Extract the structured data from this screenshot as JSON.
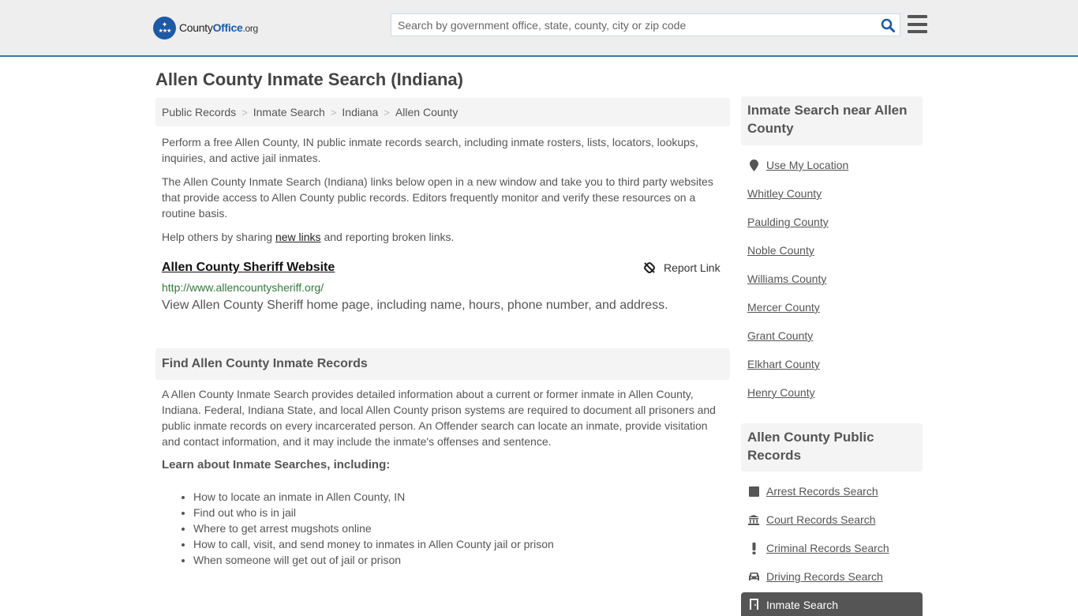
{
  "header": {
    "logo": {
      "brand_part1": "County",
      "brand_part2": "Office",
      "brand_suffix": ".org"
    },
    "search": {
      "placeholder": "Search by government office, state, county, city or zip code",
      "value": ""
    }
  },
  "page": {
    "title": "Allen County Inmate Search (Indiana)"
  },
  "breadcrumb": [
    {
      "label": "Public Records"
    },
    {
      "label": "Inmate Search"
    },
    {
      "label": "Indiana"
    },
    {
      "label": "Allen County"
    }
  ],
  "intro": {
    "para1": "Perform a free Allen County, IN public inmate records search, including inmate rosters, lists, locators, lookups, inquiries, and active jail inmates.",
    "para2": "The Allen County Inmate Search (Indiana) links below open in a new window and take you to third party websites that provide access to Allen County public records. Editors frequently monitor and verify these resources on a routine basis.",
    "para3_before": "Help others by sharing ",
    "para3_link": "new links",
    "para3_after": " and reporting broken links."
  },
  "results": [
    {
      "title": "Allen County Sheriff Website",
      "url": "http://www.allencountysheriff.org/",
      "description": "View Allen County Sheriff home page, including name, hours, phone number, and address.",
      "report_label": "Report Link"
    }
  ],
  "find_section": {
    "heading": "Find Allen County Inmate Records",
    "body": "A Allen County Inmate Search provides detailed information about a current or former inmate in Allen County, Indiana. Federal, Indiana State, and local Allen County prison systems are required to document all prisoners and public inmate records on every incarcerated person. An Offender search can locate an inmate, provide visitation and contact information, and it may include the inmate's offenses and sentence.",
    "learn_heading": "Learn about Inmate Searches, including:",
    "learn_items": [
      "How to locate an inmate in Allen County, IN",
      "Find out who is in jail",
      "Where to get arrest mugshots online",
      "How to call, visit, and send money to inmates in Allen County jail or prison",
      "When someone will get out of jail or prison"
    ]
  },
  "sidebar": {
    "nearby": {
      "heading": "Inmate Search near Allen County",
      "use_location": "Use My Location",
      "counties": [
        "Whitley County",
        "Paulding County",
        "Noble County",
        "Williams County",
        "Mercer County",
        "Grant County",
        "Elkhart County",
        "Henry County"
      ]
    },
    "public_records": {
      "heading": "Allen County Public Records",
      "items": [
        {
          "label": "Arrest Records Search",
          "icon": "square-icon"
        },
        {
          "label": "Court Records Search",
          "icon": "courthouse-icon"
        },
        {
          "label": "Criminal Records Search",
          "icon": "exclamation-icon"
        },
        {
          "label": "Driving Records Search",
          "icon": "car-icon"
        }
      ],
      "active_item": {
        "label": "Inmate Search",
        "icon": "door-icon"
      }
    }
  },
  "colors": {
    "brand_blue": "#1d5aa5",
    "header_border": "#3b79a9",
    "url_green": "#317a3a",
    "panel_gray": "#f4f4f4",
    "active_item_bg": "#555555"
  }
}
